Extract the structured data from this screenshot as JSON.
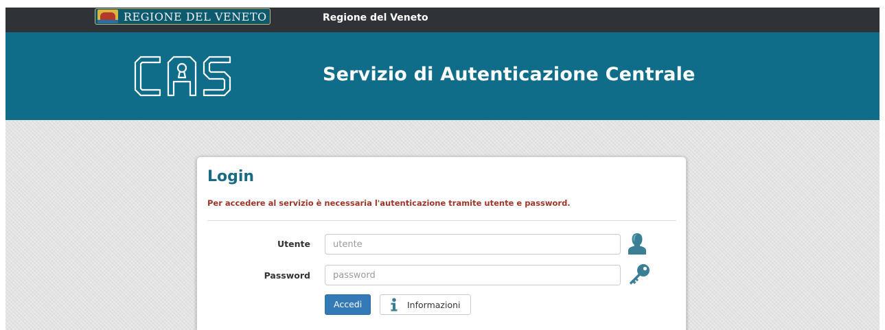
{
  "topbar": {
    "region_logo_text": "REGIONE DEL VENETO",
    "title": "Regione del Veneto"
  },
  "banner": {
    "logo_text": "CAS",
    "title": "Servizio di Autenticazione Centrale"
  },
  "login": {
    "heading": "Login",
    "message": "Per accedere al servizio è necessaria l'autenticazione tramite utente e password.",
    "username": {
      "label": "Utente",
      "placeholder": "utente",
      "value": "",
      "icon": "user-icon"
    },
    "password": {
      "label": "Password",
      "placeholder": "password",
      "value": "",
      "icon": "key-icon"
    },
    "submit_label": "Accedi",
    "info_button": {
      "label": "Informazioni",
      "icon": "info-icon"
    }
  },
  "colors": {
    "topbar_bg": "#2f3236",
    "banner_bg": "#0f6d8a",
    "heading": "#1a6a86",
    "message": "#9d3528",
    "primary_button": "#337ab7",
    "icon_color": "#3a7f96",
    "page_bg": "#e4e4e4"
  }
}
